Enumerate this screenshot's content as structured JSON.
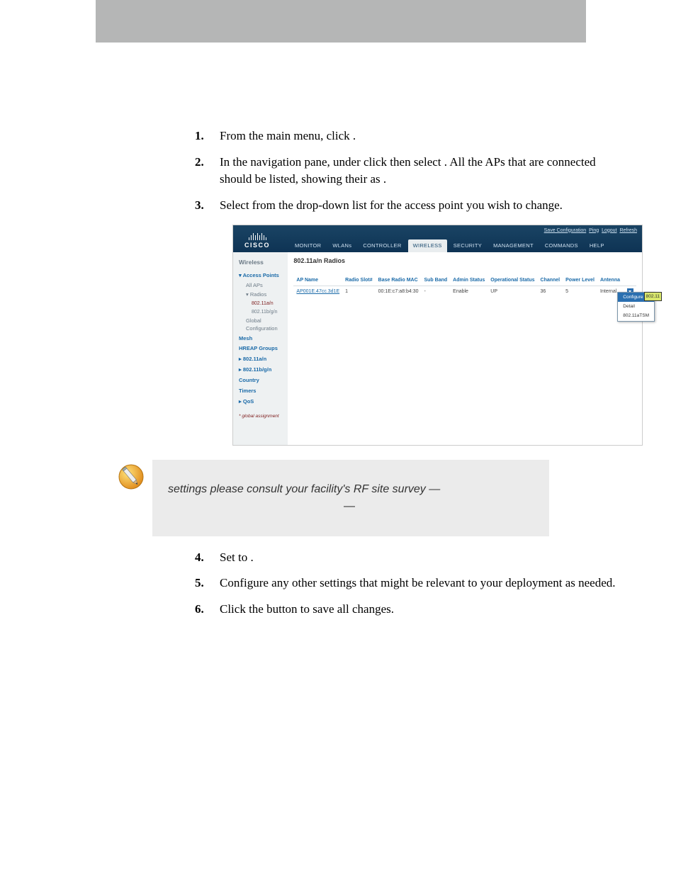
{
  "steps": {
    "s1": {
      "num": "1.",
      "part1": "From the main menu, click ",
      "part2": "."
    },
    "s2": {
      "num": "2.",
      "part1": "In the navigation pane, under ",
      "part2": " click ",
      "part3": " then select ",
      "part4": ". All the APs that are connected should be listed, showing their ",
      "part5": " as ",
      "part6": "."
    },
    "s3": {
      "num": "3.",
      "text": "Select ",
      "text2": " from the drop-down list for the access point you wish to change."
    },
    "s4": {
      "num": "4.",
      "part1": "Set ",
      "part2": " to ",
      "part3": "."
    },
    "s5": {
      "num": "5.",
      "text": "Configure any other settings that might be relevant to your deployment as needed."
    },
    "s6": {
      "num": "6.",
      "part1": "Click the ",
      "part2": " button to save all changes."
    }
  },
  "note": {
    "line1": " settings please consult your facility's RF site survey — ",
    "line2": " — "
  },
  "wlc": {
    "logo": "CISCO",
    "toplinks": {
      "save": "Save Configuration",
      "ping": "Ping",
      "logout": "Logout",
      "refresh": "Refresh"
    },
    "nav": {
      "monitor": "MONITOR",
      "wlans": "WLANs",
      "controller": "CONTROLLER",
      "wireless": "WIRELESS",
      "security": "SECURITY",
      "management": "MANAGEMENT",
      "commands": "COMMANDS",
      "help": "HELP"
    },
    "side": {
      "title": "Wireless",
      "ap": "Access Points",
      "allaps": "All APs",
      "radios": "Radios",
      "r_a": "802.11a/n",
      "r_b": "802.11b/g/n",
      "globalcfg": "Global Configuration",
      "mesh": "Mesh",
      "hreap": "HREAP Groups",
      "g_a": "802.11a/n",
      "g_b": "802.11b/g/n",
      "country": "Country",
      "timers": "Timers",
      "qos": "QoS",
      "foot": "* global assignment"
    },
    "main": {
      "title": "802.11a/n Radios",
      "th": {
        "apname": "AP Name",
        "slot": "Radio Slot#",
        "mac": "Base Radio MAC",
        "sub": "Sub Band",
        "admin": "Admin Status",
        "op": "Operational Status",
        "chan": "Channel",
        "pwr": "Power Level",
        "ant": "Antenna"
      },
      "row": {
        "apname": "AP001E.47cc.3d1E",
        "slot": "1",
        "mac": "00:1E:c7:a8:b4:30",
        "sub": "-",
        "admin": "Enable",
        "op": "UP",
        "chan": "36",
        "pwr": "5",
        "ant": "Internal"
      },
      "ctx": {
        "configure": "Configure",
        "detail": "Detail",
        "tsm": "802.11aTSM"
      },
      "ctx_tag": "802.11"
    }
  }
}
